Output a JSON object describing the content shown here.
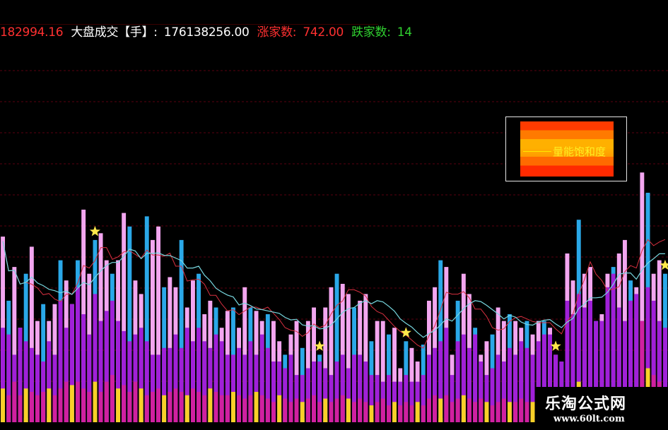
{
  "header": {
    "prefix_value": "182994.16",
    "turnover_label": "大盘成交【手】:",
    "turnover_value": "176138256.00",
    "up_label": "涨家数:",
    "up_value": "742.00",
    "down_label": "跌家数:",
    "down_value": "14"
  },
  "legend": {
    "label": "量能饱和度"
  },
  "watermark": {
    "title": "乐淘公式网",
    "url": "www.60lt.com"
  },
  "colors": {
    "pink": "#f3a6f0",
    "blue": "#2aa8e8",
    "purple": "#a020d8",
    "magenta": "#d020a0",
    "yellow": "#f8d028",
    "cyan_line": "#78d8e0",
    "red_line": "#d83040",
    "star": "#ffe84a",
    "grid": "#5a0010"
  },
  "chart_data": {
    "type": "bar",
    "title": "",
    "xlabel": "",
    "ylabel": "",
    "ylim": [
      0,
      1
    ],
    "grid": true,
    "series": [
      {
        "values": [
          0.55,
          0.36,
          0.46,
          0.28,
          0.44,
          0.52,
          0.3,
          0.35,
          0.3,
          0.35,
          0.48,
          0.42,
          0.35,
          0.48,
          0.63,
          0.44,
          0.54,
          0.56,
          0.48,
          0.44,
          0.48,
          0.62,
          0.58,
          0.42,
          0.38,
          0.61,
          0.54,
          0.58,
          0.4,
          0.43,
          0.4,
          0.54,
          0.34,
          0.42,
          0.44,
          0.32,
          0.36,
          0.34,
          0.28,
          0.33,
          0.34,
          0.28,
          0.4,
          0.34,
          0.33,
          0.3,
          0.32,
          0.3,
          0.24,
          0.2,
          0.26,
          0.3,
          0.22,
          0.3,
          0.34,
          0.2,
          0.34,
          0.4,
          0.44,
          0.41,
          0.38,
          0.34,
          0.36,
          0.38,
          0.24,
          0.3,
          0.3,
          0.26,
          0.28,
          0.16,
          0.24,
          0.22,
          0.18,
          0.23,
          0.36,
          0.4,
          0.48,
          0.46,
          0.2,
          0.36,
          0.44,
          0.38,
          0.28,
          0.2,
          0.24,
          0.26,
          0.34,
          0.3,
          0.32,
          0.3,
          0.28,
          0.3,
          0.26,
          0.3,
          0.3,
          0.28,
          0.2,
          0.18,
          0.5,
          0.42,
          0.6,
          0.44,
          0.46,
          0.3,
          0.32,
          0.44,
          0.46,
          0.5,
          0.54,
          0.42,
          0.4,
          0.74,
          0.68,
          0.44,
          0.48,
          0.44
        ]
      },
      {
        "values": [
          0.28,
          0.26,
          0.2,
          0.34,
          0.24,
          0.22,
          0.2,
          0.18,
          0.24,
          0.2,
          0.36,
          0.28,
          0.38,
          0.4,
          0.32,
          0.26,
          0.38,
          0.3,
          0.33,
          0.36,
          0.3,
          0.27,
          0.24,
          0.26,
          0.28,
          0.24,
          0.2,
          0.2,
          0.22,
          0.22,
          0.26,
          0.22,
          0.28,
          0.24,
          0.28,
          0.24,
          0.22,
          0.26,
          0.24,
          0.2,
          0.2,
          0.22,
          0.2,
          0.24,
          0.2,
          0.26,
          0.22,
          0.18,
          0.18,
          0.16,
          0.2,
          0.14,
          0.14,
          0.16,
          0.18,
          0.18,
          0.16,
          0.14,
          0.18,
          0.2,
          0.16,
          0.2,
          0.2,
          0.18,
          0.14,
          0.14,
          0.12,
          0.14,
          0.12,
          0.12,
          0.14,
          0.12,
          0.12,
          0.14,
          0.2,
          0.22,
          0.24,
          0.28,
          0.14,
          0.24,
          0.26,
          0.22,
          0.26,
          0.18,
          0.14,
          0.16,
          0.2,
          0.18,
          0.22,
          0.2,
          0.24,
          0.22,
          0.2,
          0.24,
          0.26,
          0.26,
          0.3,
          0.28,
          0.36,
          0.32,
          0.38,
          0.34,
          0.36,
          0.34,
          0.3,
          0.4,
          0.44,
          0.34,
          0.3,
          0.36,
          0.38,
          0.3,
          0.4,
          0.36,
          0.3,
          0.28
        ]
      },
      {
        "values": [
          0.1,
          0.08,
          0.12,
          0.08,
          0.1,
          0.09,
          0.08,
          0.09,
          0.1,
          0.08,
          0.1,
          0.12,
          0.11,
          0.12,
          0.1,
          0.09,
          0.12,
          0.09,
          0.12,
          0.14,
          0.1,
          0.11,
          0.09,
          0.12,
          0.1,
          0.08,
          0.09,
          0.1,
          0.08,
          0.09,
          0.1,
          0.09,
          0.08,
          0.1,
          0.09,
          0.08,
          0.1,
          0.09,
          0.08,
          0.08,
          0.09,
          0.08,
          0.07,
          0.08,
          0.09,
          0.08,
          0.07,
          0.06,
          0.08,
          0.07,
          0.06,
          0.07,
          0.06,
          0.07,
          0.08,
          0.06,
          0.07,
          0.06,
          0.07,
          0.08,
          0.07,
          0.06,
          0.07,
          0.06,
          0.05,
          0.06,
          0.07,
          0.05,
          0.06,
          0.05,
          0.06,
          0.05,
          0.06,
          0.05,
          0.07,
          0.08,
          0.07,
          0.08,
          0.06,
          0.07,
          0.08,
          0.07,
          0.06,
          0.07,
          0.06,
          0.05,
          0.06,
          0.07,
          0.06,
          0.06,
          0.07,
          0.06,
          0.06,
          0.05,
          0.06,
          0.06,
          0.07,
          0.06,
          0.1,
          0.08,
          0.12,
          0.09,
          0.08,
          0.07,
          0.08,
          0.09,
          0.1,
          0.08,
          0.07,
          0.09,
          0.08,
          0.4,
          0.16,
          0.14,
          0.12,
          0.1
        ]
      }
    ],
    "stars": [
      16,
      55,
      70,
      96,
      115,
      137
    ]
  }
}
